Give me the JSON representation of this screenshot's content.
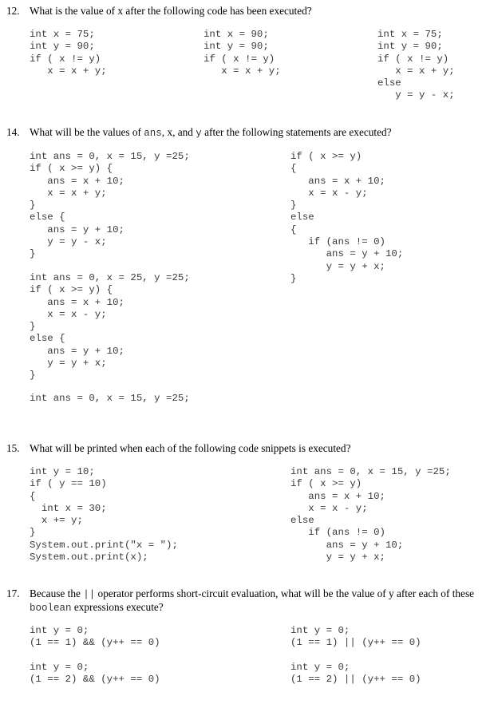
{
  "q12": {
    "number": "12.",
    "text": "What is the value of x after the following code has been executed?",
    "snippets": [
      "int x = 75;\nint y = 90;\nif ( x != y)\n   x = x + y;",
      "int x = 90;\nint y = 90;\nif ( x != y)\n   x = x + y;",
      "int x = 75;\nint y = 90;\nif ( x != y)\n   x = x + y;\nelse\n   y = y - x;"
    ]
  },
  "q14": {
    "number": "14.",
    "text_before": "What will be the values of ",
    "code_ans": "ans",
    "sep1": ", ",
    "code_x": "x",
    "sep2": ", and ",
    "code_y": "y",
    "text_after": " after the following statements are executed?",
    "snippets": [
      "int ans = 0, x = 15, y =25;\nif ( x >= y) {\n   ans = x + 10;\n   x = x + y;\n}\nelse {\n   ans = y + 10;\n   y = y - x;\n}",
      "if ( x >= y)\n{\n   ans = x + 10;\n   x = x - y;\n}\nelse\n{\n   if (ans != 0)\n      ans = y + 10;\n      y = y + x;\n}",
      "int ans = 0, x = 25, y =25;\nif ( x >= y) {\n   ans = x + 10;\n   x = x - y;\n}\nelse {\n   ans = y + 10;\n   y = y + x;\n}",
      "int ans = 0, x = 15, y =25;"
    ]
  },
  "q15": {
    "number": "15.",
    "text": "What will be printed when each of the following code snippets is executed?",
    "snippets": [
      "int y = 10;\nif ( y == 10)\n{\n  int x = 30;\n  x += y;\n}\nSystem.out.print(\"x = \");\nSystem.out.print(x);",
      "int ans = 0, x = 15, y =25;\nif ( x >= y)\n   ans = x + 10;\n   x = x - y;\nelse\n   if (ans != 0)\n      ans = y + 10;\n      y = y + x;"
    ]
  },
  "q17": {
    "number": "17.",
    "text_before": "Because the ",
    "code_op": "||",
    "text_after": " operator performs short-circuit evaluation, what will be the value of y after each of these",
    "code_boolean": "boolean",
    "text_line2": " expressions execute?",
    "snippets": [
      "int y = 0;\n(1 == 1) && (y++ == 0)",
      "int y = 0;\n(1 == 1) || (y++ == 0)",
      "int y = 0;\n(1 == 2) && (y++ == 0)",
      "int y = 0;\n(1 == 2) || (y++ == 0)"
    ]
  }
}
